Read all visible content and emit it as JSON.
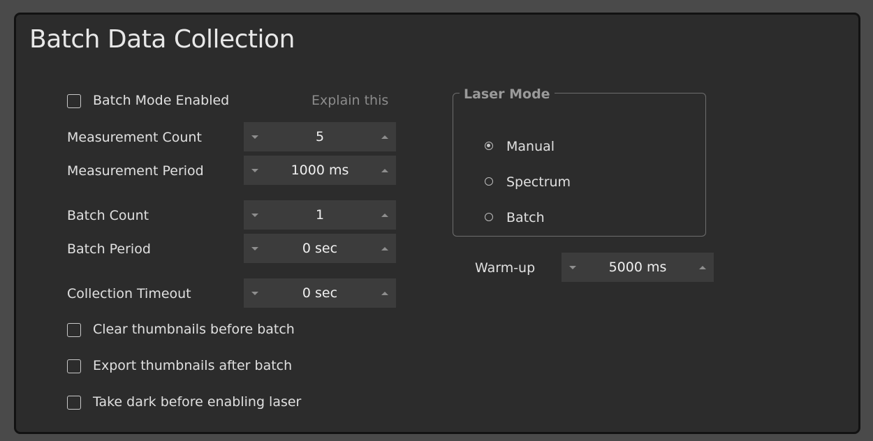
{
  "panel": {
    "title": "Batch Data Collection"
  },
  "batch_mode": {
    "label": "Batch Mode Enabled",
    "checked": false,
    "explain_link": "Explain this"
  },
  "fields": {
    "measurement_count": {
      "label": "Measurement Count",
      "value": "5"
    },
    "measurement_period": {
      "label": "Measurement Period",
      "value": "1000 ms"
    },
    "batch_count": {
      "label": "Batch Count",
      "value": "1"
    },
    "batch_period": {
      "label": "Batch Period",
      "value": "0 sec"
    },
    "collection_timeout": {
      "label": "Collection Timeout",
      "value": "0 sec"
    }
  },
  "options": {
    "clear_thumbnails": {
      "label": "Clear thumbnails before batch",
      "checked": false
    },
    "export_thumbnails": {
      "label": "Export thumbnails after batch",
      "checked": false
    },
    "take_dark": {
      "label": "Take dark before enabling laser",
      "checked": false
    }
  },
  "laser_mode": {
    "legend": "Laser Mode",
    "selected": "Manual",
    "options": [
      "Manual",
      "Spectrum",
      "Batch"
    ]
  },
  "warmup": {
    "label": "Warm-up",
    "value": "5000 ms"
  },
  "colors": {
    "panel_bg": "#2c2c2c",
    "spinbox_bg": "#3c3c3c",
    "text": "#e0e0e0",
    "muted_text": "#8c8c8c"
  }
}
